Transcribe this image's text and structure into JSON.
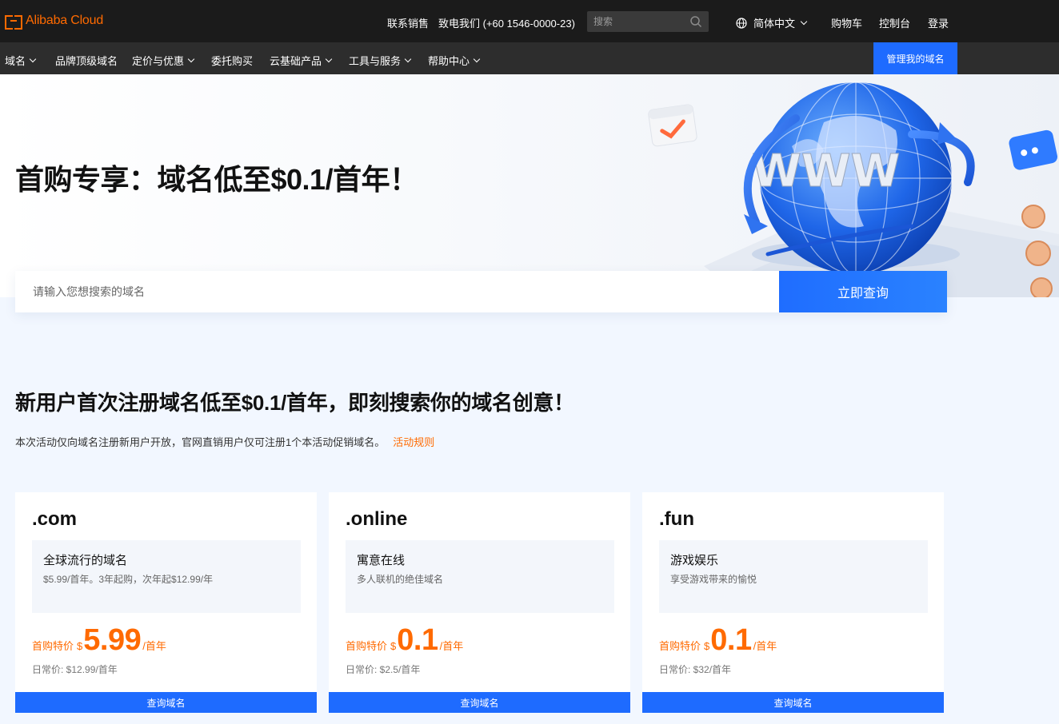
{
  "topbar": {
    "logo_text": "Alibaba Cloud",
    "contact_sales": "联系销售",
    "phone": "致电我们 (+60 1546-0000-23)",
    "search_placeholder": "搜索",
    "language": "简体中文",
    "cart": "购物车",
    "console": "控制台",
    "login": "登录"
  },
  "nav": {
    "items": [
      {
        "label": "域名",
        "dropdown": true
      },
      {
        "label": "品牌顶级域名",
        "dropdown": false
      },
      {
        "label": "定价与优惠",
        "dropdown": true
      },
      {
        "label": "委托购买",
        "dropdown": false
      },
      {
        "label": "云基础产品",
        "dropdown": true
      },
      {
        "label": "工具与服务",
        "dropdown": true
      },
      {
        "label": "帮助中心",
        "dropdown": true
      }
    ],
    "manage_button": "管理我的域名"
  },
  "hero": {
    "title": "首购专享：域名低至$0.1/首年！",
    "art_text": "WWW"
  },
  "search": {
    "placeholder": "请输入您想搜索的域名",
    "button": "立即查询"
  },
  "section": {
    "title": "新用户首次注册域名低至$0.1/首年，即刻搜索你的域名创意！",
    "note": "本次活动仅向域名注册新用户开放，官网直销用户仅可注册1个本活动促销域名。",
    "rules_link": "活动规则"
  },
  "cards": [
    {
      "tld": ".com",
      "info_title": "全球流行的域名",
      "info_desc": "$5.99/首年。3年起购，次年起$12.99/年",
      "price_label": "首购特价",
      "currency": "$",
      "price": "5.99",
      "unit": "/首年",
      "regular": "日常价:   $12.99/首年",
      "button": "查询域名"
    },
    {
      "tld": ".online",
      "info_title": "寓意在线",
      "info_desc": "多人联机的绝佳域名",
      "price_label": "首购特价",
      "currency": "$",
      "price": "0.1",
      "unit": "/首年",
      "regular": "日常价:   $2.5/首年",
      "button": "查询域名"
    },
    {
      "tld": ".fun",
      "info_title": "游戏娱乐",
      "info_desc": "享受游戏带来的愉悦",
      "price_label": "首购特价",
      "currency": "$",
      "price": "0.1",
      "unit": "/首年",
      "regular": "日常价:   $32/首年",
      "button": "查询域名"
    }
  ],
  "colors": {
    "accent_blue": "#1e6bff",
    "accent_orange": "#ff6a00",
    "topbar_bg": "#1b1b1b",
    "navbar_bg": "#2d2d2d"
  }
}
